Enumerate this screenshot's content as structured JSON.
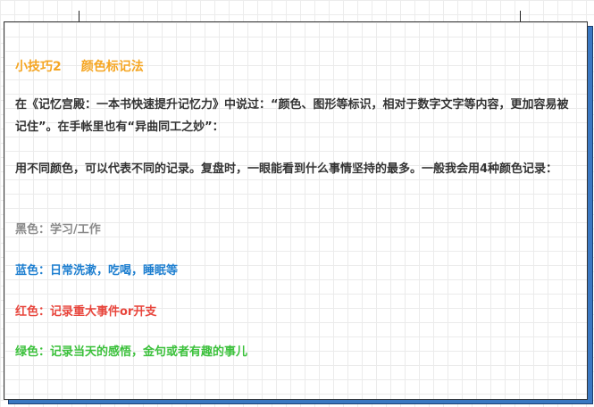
{
  "title": {
    "number": "小技巧2",
    "name": "颜色标记法"
  },
  "paragraphs": [
    "在《记忆宫殿：一本书快速提升记忆力》中说过：“颜色、图形等标识，相对于数字文字等内容，更加容易被记住”。在手帐里也有“异曲同工之妙”：",
    "用不同颜色，可以代表不同的记录。复盘时，一眼能看到什么事情坚持的最多。一般我会用4种颜色记录："
  ],
  "colors": [
    {
      "text": "黑色：学习/工作",
      "color": "#8a8a8a"
    },
    {
      "text": "蓝色：日常洗漱，吃喝，睡眠等",
      "color": "#1e7fd0"
    },
    {
      "text": "红色：记录重大事件or开支",
      "color": "#e8453c"
    },
    {
      "text": "绿色：记录当天的感悟，金句或者有趣的事儿",
      "color": "#3cc13c"
    }
  ]
}
